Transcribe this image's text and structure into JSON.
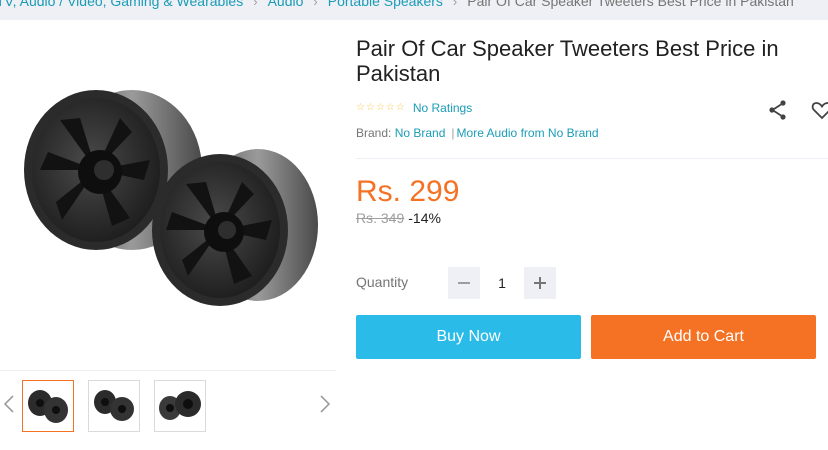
{
  "breadcrumb": {
    "items": [
      "TV, Audio / Video, Gaming & Wearables",
      "Audio",
      "Portable Speakers"
    ],
    "current": "Pair Of Car Speaker Tweeters Best Price in Pakistan"
  },
  "gallery": {
    "main_image": "car-speaker-tweeters-photo",
    "thumbnails": [
      "car-speaker-tweeters-photo",
      "car-speaker-tweeters-photo",
      "car-speaker-tweeters-photo"
    ],
    "active_thumbnail": 0
  },
  "product": {
    "title": "Pair Of Car Speaker Tweeters Best Price in Pakistan",
    "rating": {
      "stars_filled": 0,
      "stars_total": 5,
      "label": "No Ratings"
    },
    "brand_label": "Brand:",
    "brand_name": "No Brand",
    "more_from": "More Audio from No Brand",
    "price": "Rs. 299",
    "original_price": "Rs. 349",
    "discount": "-14%"
  },
  "quantity": {
    "label": "Quantity",
    "value": "1",
    "minus": "−",
    "plus": "+"
  },
  "actions": {
    "buy_now": "Buy Now",
    "add_to_cart": "Add to Cart"
  },
  "colors": {
    "price": "#f57224",
    "link": "#1a9cb7",
    "buy_now": "#2abbe8",
    "add_to_cart": "#f57224",
    "star": "#faca51"
  },
  "icons": [
    "chevron-left-icon",
    "chevron-right-icon",
    "share-icon",
    "heart-icon",
    "star-outline-icon",
    "minus-icon",
    "plus-icon"
  ]
}
